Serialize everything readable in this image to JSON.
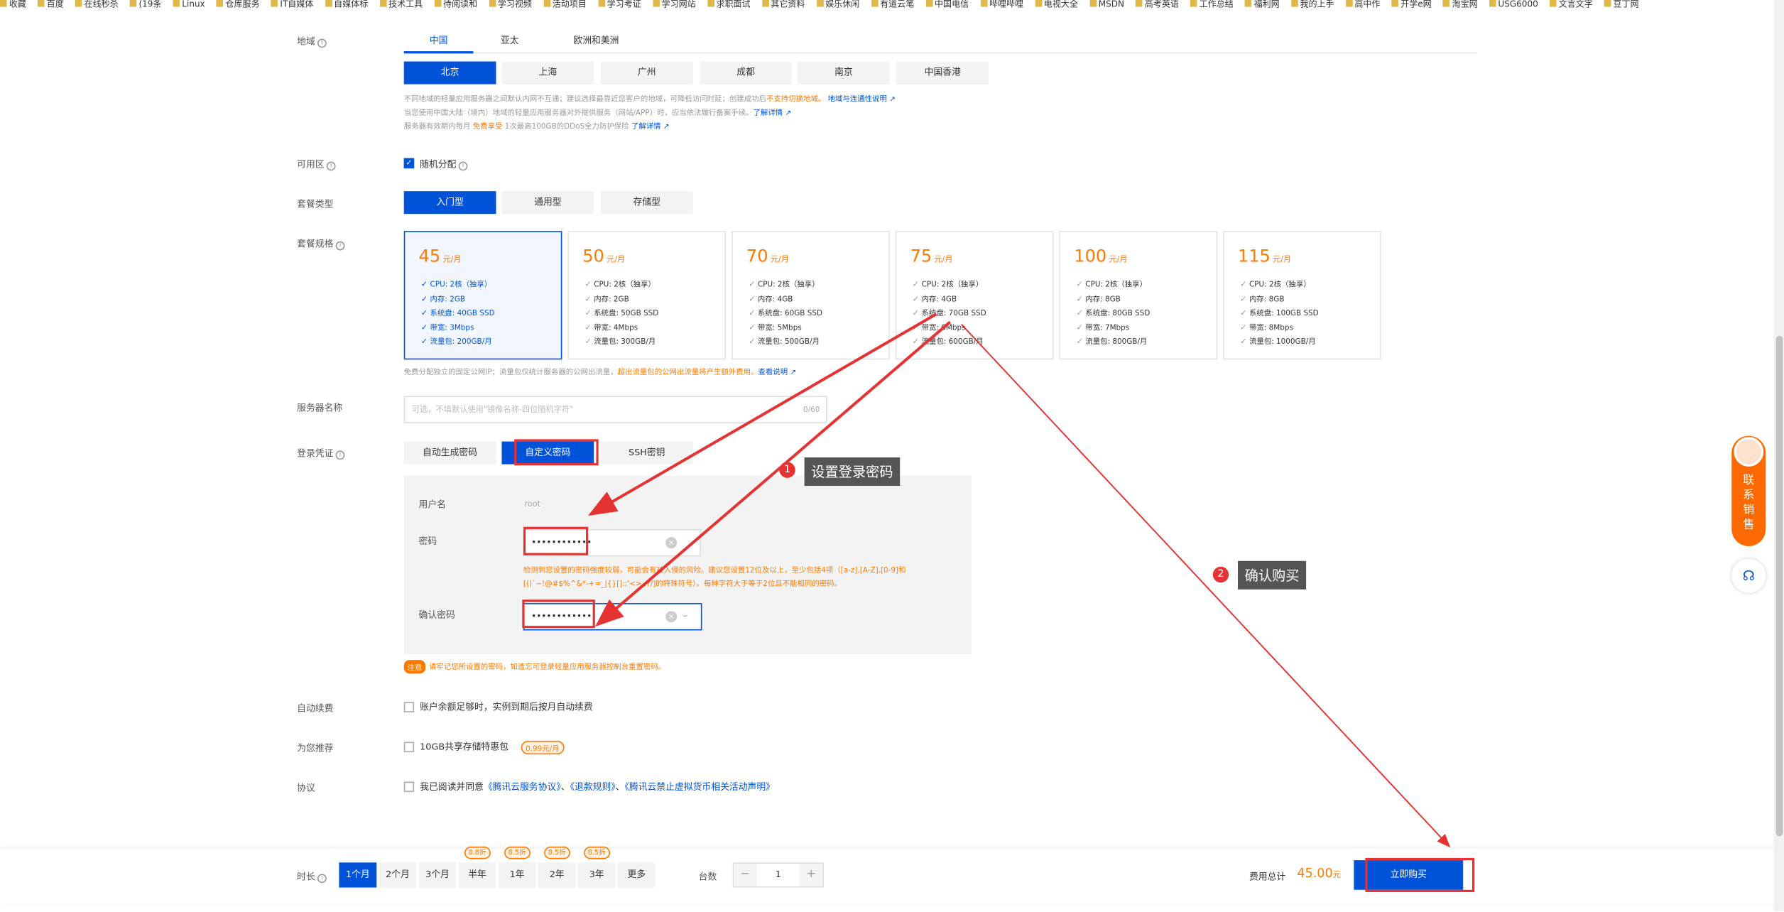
{
  "bookmarks": [
    "收藏",
    "百度",
    "在线秒杀",
    "(19条",
    "Linux",
    "仓库服务",
    "IT自媒体",
    "自媒体标",
    "技术工具",
    "待阅读和",
    "学习视频",
    "活动项目",
    "学习考证",
    "学习网站",
    "求职面试",
    "其它资料",
    "娱乐休闲",
    "有道云笔",
    "中国电信",
    "哔哩哔哩",
    "电视大全",
    "MSDN",
    "高考英语",
    "工作总结",
    "福利网",
    "我的上手",
    "高中作",
    "开学e网",
    "淘宝网",
    "USG6000",
    "文言文字",
    "豆丁网"
  ],
  "region": {
    "label": "地域",
    "tabs": [
      "中国",
      "亚太",
      "欧洲和美洲"
    ],
    "cities": [
      "北京",
      "上海",
      "广州",
      "成都",
      "南京",
      "中国香港"
    ],
    "note1": "不同地域的轻量应用服务器之间默认内网不互通；建议选择最靠近您客户的地域，可降低访问时延；创建成功后",
    "note1_warn": "不支持切换地域。",
    "note1_link": "地域与连通性说明",
    "note2": "当您使用中国大陆（境内）地域的轻量应用服务器对外提供服务（网站/APP）时，应当依法履行备案手续。",
    "note2_link": "了解详情",
    "note3": "服务器有效期内每月",
    "note3_warn": "免费享受",
    "note3_b": "1次最高100GB的DDoS全力防护保险",
    "note3_link": "了解详情"
  },
  "az": {
    "label": "可用区",
    "option": "随机分配"
  },
  "package_type": {
    "label": "套餐类型",
    "options": [
      "入门型",
      "通用型",
      "存储型"
    ]
  },
  "package_spec": {
    "label": "套餐规格",
    "unit": "元/月",
    "cards": [
      {
        "price": "45",
        "cpu": "CPU: 2核（独享）",
        "mem": "内存: 2GB",
        "disk": "系统盘: 40GB SSD",
        "bw": "带宽: 3Mbps",
        "traffic": "流量包: 200GB/月"
      },
      {
        "price": "50",
        "cpu": "CPU: 2核（独享）",
        "mem": "内存: 2GB",
        "disk": "系统盘: 50GB SSD",
        "bw": "带宽: 4Mbps",
        "traffic": "流量包: 300GB/月"
      },
      {
        "price": "70",
        "cpu": "CPU: 2核（独享）",
        "mem": "内存: 4GB",
        "disk": "系统盘: 60GB SSD",
        "bw": "带宽: 5Mbps",
        "traffic": "流量包: 500GB/月"
      },
      {
        "price": "75",
        "cpu": "CPU: 2核（独享）",
        "mem": "内存: 4GB",
        "disk": "系统盘: 70GB SSD",
        "bw": "带宽: 6Mbps",
        "traffic": "流量包: 600GB/月"
      },
      {
        "price": "100",
        "cpu": "CPU: 2核（独享）",
        "mem": "内存: 8GB",
        "disk": "系统盘: 80GB SSD",
        "bw": "带宽: 7Mbps",
        "traffic": "流量包: 800GB/月"
      },
      {
        "price": "115",
        "cpu": "CPU: 2核（独享）",
        "mem": "内存: 8GB",
        "disk": "系统盘: 100GB SSD",
        "bw": "带宽: 8Mbps",
        "traffic": "流量包: 1000GB/月"
      }
    ],
    "note": "免费分配独立的固定公网IP；流量包仅统计服务器的公网出流量，",
    "note_warn": "超出流量包的公网出流量将产生额外费用。",
    "note_link": "查看说明"
  },
  "server_name": {
    "label": "服务器名称",
    "placeholder": "可选，不填默认使用\"镜像名称-四位随机字符\"",
    "count": "0/60"
  },
  "login": {
    "label": "登录凭证",
    "tabs": [
      "自动生成密码",
      "自定义密码",
      "SSH密钥"
    ],
    "username_label": "用户名",
    "username": "root",
    "password_label": "密码",
    "password": "••••••••••••",
    "confirm_label": "确认密码",
    "confirm": "••••••••••••",
    "warn": "检测到您设置的密码强度较弱，可能会有被入侵的风险。建议您设置12位及以上，至少包括4项（[a-z],[A-Z],[0-9]和[()`~!@#$%^&*-+=_|{}[]:;'<>,.?/]的特殊符号）。每种字符大于等于2位且不能相同的密码。",
    "notice_tag": "注意",
    "notice": "请牢记您所设置的密码，如遗忘可登录轻量应用服务器控制台重置密码。"
  },
  "auto_renew": {
    "label": "自动续费",
    "text": "账户余额足够时，实例到期后按月自动续费"
  },
  "recommend": {
    "label": "为您推荐",
    "text": "10GB共享存储特惠包",
    "price": "0.99元/月"
  },
  "agreement": {
    "label": "协议",
    "text": "我已阅读并同意",
    "link1": "《腾讯云服务协议》",
    "sep1": "、",
    "link2": "《退款规则》",
    "sep2": "、",
    "link3": "《腾讯云禁止虚拟货币相关活动声明》"
  },
  "annotations": {
    "step1": "1",
    "step1_text": "设置登录密码",
    "step2": "2",
    "step2_text": "确认购买"
  },
  "footer": {
    "duration_label": "时长",
    "durations": [
      {
        "label": "1个月",
        "discount": ""
      },
      {
        "label": "2个月",
        "discount": ""
      },
      {
        "label": "3个月",
        "discount": ""
      },
      {
        "label": "半年",
        "discount": "8.8折"
      },
      {
        "label": "1年",
        "discount": "8.5折"
      },
      {
        "label": "2年",
        "discount": "8.5折"
      },
      {
        "label": "3年",
        "discount": "8.5折"
      },
      {
        "label": "更多",
        "discount": ""
      }
    ],
    "qty_label": "台数",
    "qty": "1",
    "minus": "−",
    "plus": "+",
    "total_label": "费用总计",
    "total": "45.00",
    "total_unit": "元",
    "buy_label": "立即购买"
  },
  "sidebar": {
    "contact": "联系销售"
  }
}
